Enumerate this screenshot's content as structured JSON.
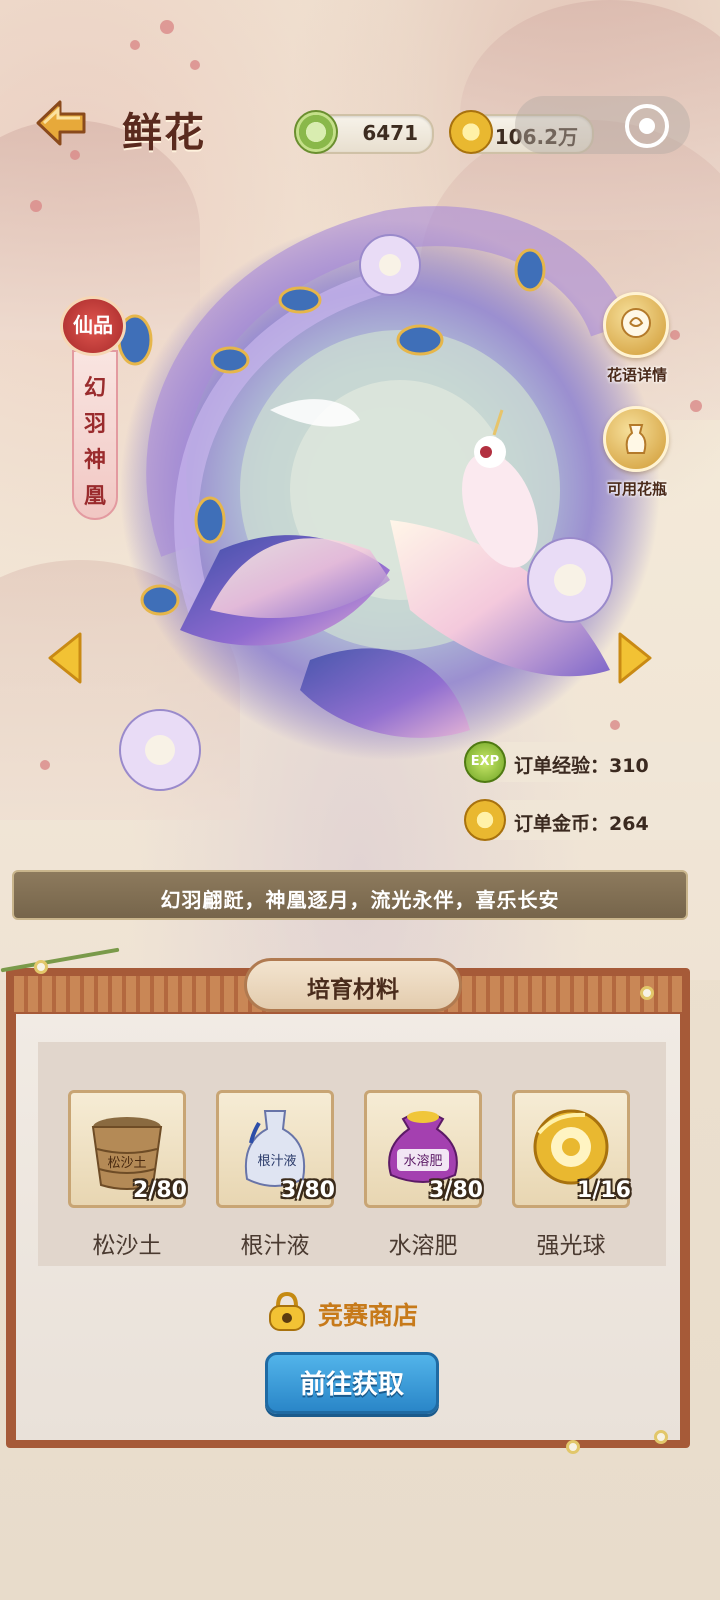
{
  "header": {
    "title": "鲜花",
    "back_icon": "arrow-left-icon",
    "currencies": [
      {
        "icon": "jade-coin-icon",
        "value": "6471"
      },
      {
        "icon": "gold-coin-icon",
        "value": "106.2万"
      }
    ],
    "settings_icon": "record-icon"
  },
  "flower": {
    "rarity": "仙品",
    "name": "幻羽神凰",
    "description": "幻羽翩跹，神凰逐月，流光永伴，喜乐长安"
  },
  "side_buttons": [
    {
      "icon": "rose-icon",
      "label": "花语详情"
    },
    {
      "icon": "vase-icon",
      "label": "可用花瓶"
    }
  ],
  "rewards": [
    {
      "icon": "exp-icon",
      "text": "订单经验：310"
    },
    {
      "icon": "gold-coin-icon",
      "text": "订单金币：264"
    }
  ],
  "materials_section": {
    "title": "培育材料",
    "items": [
      {
        "name": "松沙土",
        "count": "2/80",
        "label_on_icon": "松沙土",
        "icon": "soil-bucket-icon"
      },
      {
        "name": "根汁液",
        "count": "3/80",
        "label_on_icon": "根汁液",
        "icon": "vase-bottle-icon"
      },
      {
        "name": "水溶肥",
        "count": "3/80",
        "label_on_icon": "水溶肥",
        "icon": "fertilizer-bag-icon"
      },
      {
        "name": "强光球",
        "count": "1/16",
        "icon": "light-orb-icon"
      }
    ],
    "shop_label": "竞赛商店",
    "go_button": "前往获取"
  },
  "colors": {
    "title": "#5a2a1e",
    "accent_gold": "#d09a34",
    "button_blue": "#2a86c8",
    "shop_orange": "#c77a1a",
    "frame_brown": "#a65a38"
  }
}
